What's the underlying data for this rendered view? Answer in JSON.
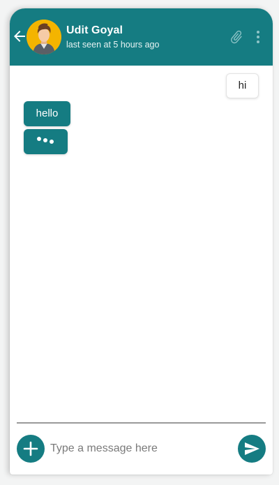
{
  "header": {
    "contact_name": "Udit Goyal",
    "status": "last seen at 5 hours ago",
    "icons": [
      "back-arrow-icon",
      "avatar",
      "paperclip-icon",
      "more-vert-icon"
    ]
  },
  "messages": [
    {
      "direction": "outgoing",
      "text": "hi"
    },
    {
      "direction": "incoming",
      "text": "hello"
    }
  ],
  "typing_indicator": {
    "direction": "incoming",
    "icon": "typing-dots-icon"
  },
  "composer": {
    "placeholder": "Type a message here",
    "value": "",
    "add_icon": "plus-icon",
    "send_icon": "send-icon"
  },
  "colors": {
    "accent": "#157c82",
    "avatar_bg": "#f4b400",
    "background": "#ffffff"
  }
}
